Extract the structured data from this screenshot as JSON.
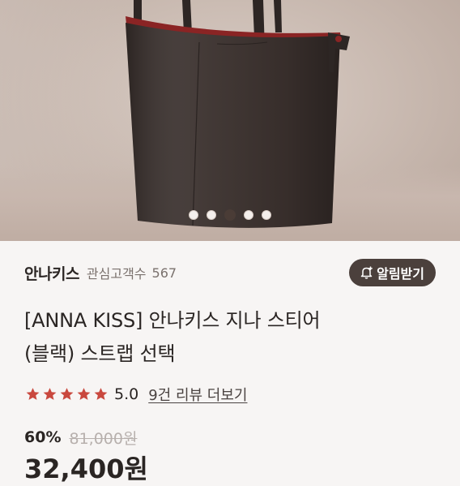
{
  "carousel": {
    "total_slides": 5,
    "active_index": 2
  },
  "product": {
    "brand": "안나키스",
    "favorites_label": "관심고객수",
    "favorites_count": "567",
    "alarm_button": "알림받기",
    "title": "[ANNA KISS] 안나키스 지나 스티어 (블랙) 스트랩 선택",
    "rating_stars": 5,
    "rating_score": "5.0",
    "review_link": "9건 리뷰 더보기",
    "discount": "60%",
    "original_price": "81,000원",
    "final_price": "32,400원"
  },
  "colors": {
    "star": "#c9483e",
    "dark": "#4b403c",
    "strikethrough": "#b7b0ad"
  }
}
